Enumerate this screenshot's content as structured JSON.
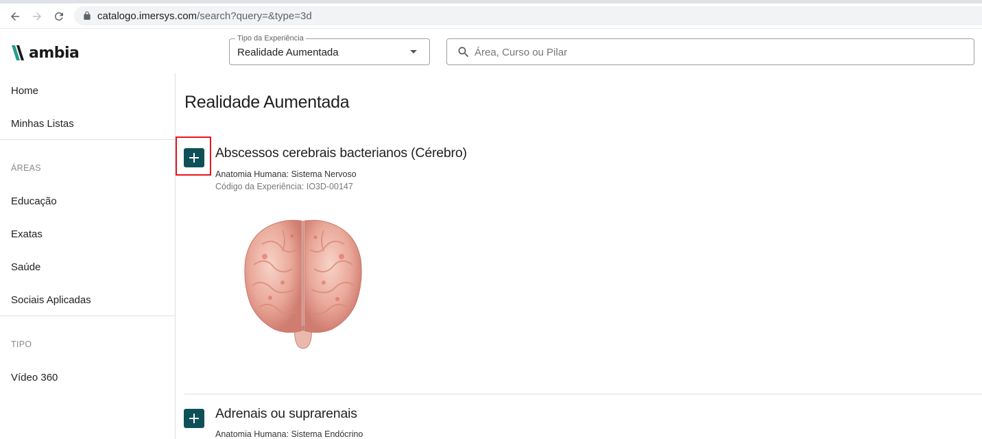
{
  "browser": {
    "url_host": "catalogo.imersys.com",
    "url_path": "/search?query=&type=3d",
    "icons": [
      "back-arrow-icon",
      "forward-arrow-icon",
      "reload-icon",
      "lock-icon"
    ]
  },
  "header": {
    "logo_text": "ambia",
    "experience_type": {
      "label": "Tipo da Experiência",
      "value": "Realidade Aumentada"
    },
    "search": {
      "placeholder": "Área, Curso ou Pilar",
      "value": ""
    }
  },
  "sidebar": {
    "top_items": [
      {
        "label": "Home"
      },
      {
        "label": "Minhas Listas"
      }
    ],
    "areas_heading": "ÁREAS",
    "areas": [
      {
        "label": "Educação"
      },
      {
        "label": "Exatas"
      },
      {
        "label": "Saúde"
      },
      {
        "label": "Sociais Aplicadas"
      }
    ],
    "tipo_heading": "TIPO",
    "tipo": [
      {
        "label": "Vídeo 360"
      }
    ]
  },
  "main": {
    "title": "Realidade Aumentada",
    "experiences": [
      {
        "title": "Abscessos cerebrais bacterianos (Cérebro)",
        "category": "Anatomia Humana: Sistema Nervoso",
        "code": "Código da Experiência: IO3D-00147",
        "image": "brain-model"
      },
      {
        "title": "Adrenais ou suprarenais",
        "category": "Anatomia Humana: Sistema Endócrino"
      }
    ]
  },
  "colors": {
    "accent": "#0f5058",
    "highlight": "#e8141b",
    "logo_mark": "#2a9a8c"
  }
}
